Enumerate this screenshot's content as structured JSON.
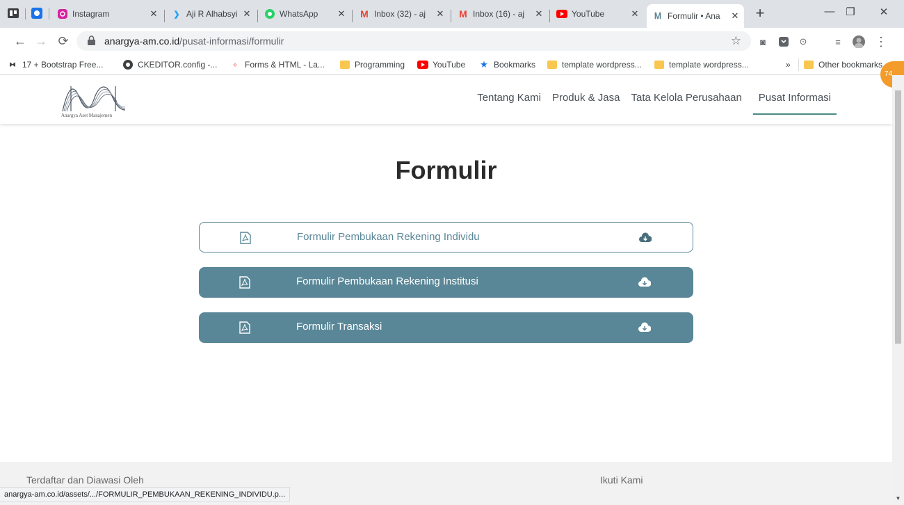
{
  "tabs": [
    {
      "title": "Instagram"
    },
    {
      "title": "Aji R Alhabsyi"
    },
    {
      "title": "WhatsApp"
    },
    {
      "title": "Inbox (32) - aj"
    },
    {
      "title": "Inbox (16) - aj"
    },
    {
      "title": "YouTube"
    },
    {
      "title": "Formulir • Ana"
    }
  ],
  "address": {
    "host": "anargya-am.co.id",
    "path": "/pusat-informasi/formulir"
  },
  "bookmarks": [
    {
      "label": "17 + Bootstrap Free..."
    },
    {
      "label": "CKEDITOR.config -..."
    },
    {
      "label": "Forms & HTML - La..."
    },
    {
      "label": "Programming"
    },
    {
      "label": "YouTube"
    },
    {
      "label": "Bookmarks"
    },
    {
      "label": "template wordpress..."
    },
    {
      "label": "template wordpress..."
    }
  ],
  "bookmarks_overflow": "»",
  "other_bookmarks": "Other bookmarks",
  "extension_badge": "74",
  "site": {
    "logo_text": "Anargya Aset Manajemen",
    "nav": [
      "Tentang Kami",
      "Produk & Jasa",
      "Tata Kelola Perusahaan",
      "Pusat Informasi"
    ],
    "active_nav": "Pusat Informasi"
  },
  "page": {
    "title": "Formulir",
    "forms": [
      {
        "label": "Formulir Pembukaan Rekening Individu",
        "style": "outline"
      },
      {
        "label": "Formulir Pembukaan Rekening Institusi",
        "style": "filled"
      },
      {
        "label": "Formulir Transaksi",
        "style": "filled"
      }
    ]
  },
  "footer": {
    "registered": "Terdaftar dan Diawasi Oleh",
    "follow": "Ikuti Kami"
  },
  "status_url": "anargya-am.co.id/assets/.../FORMULIR_PEMBUKAAN_REKENING_INDIVIDU.p...",
  "colors": {
    "accent": "#5a8797",
    "nav_underline": "#4a8a86",
    "chrome_bg": "#dee1e6"
  }
}
